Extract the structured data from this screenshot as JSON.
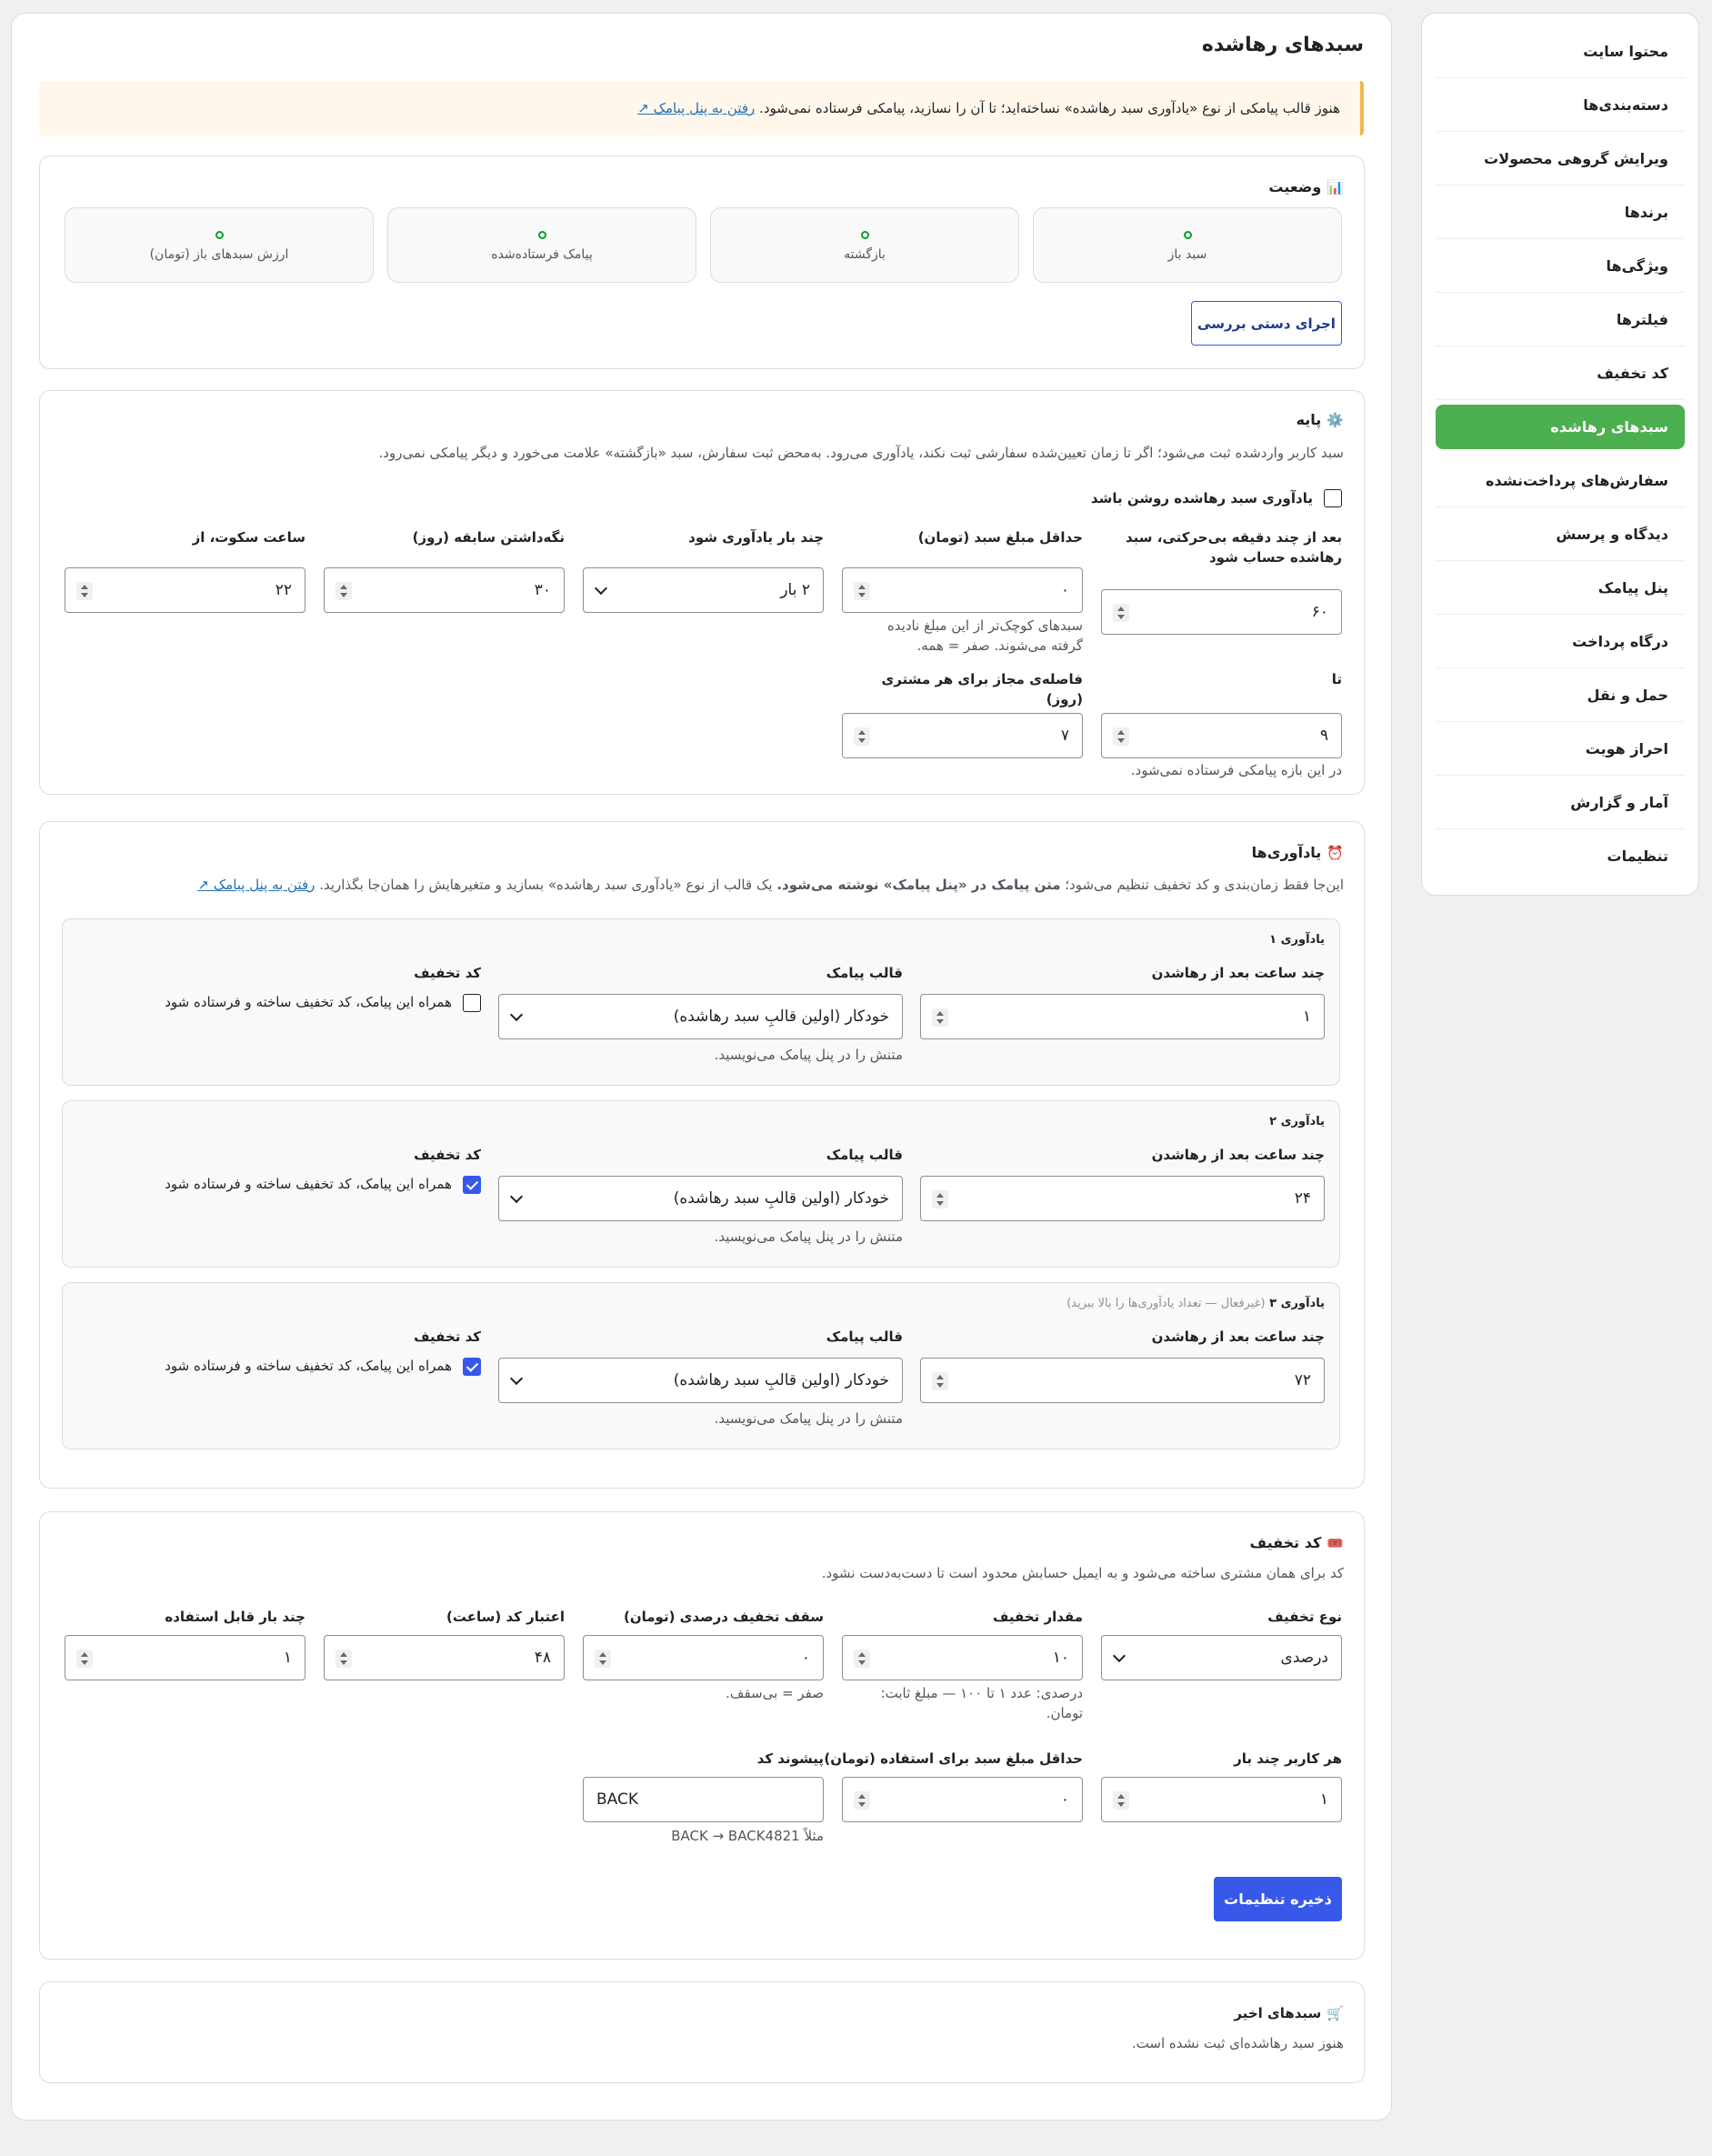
{
  "sidebar": {
    "items": [
      {
        "label": "محتوا سایت",
        "active": false
      },
      {
        "label": "دسته‌بندی‌ها",
        "active": false
      },
      {
        "label": "ویرایش گروهی محصولات",
        "active": false
      },
      {
        "label": "برندها",
        "active": false
      },
      {
        "label": "ویژگی‌ها",
        "active": false
      },
      {
        "label": "فیلترها",
        "active": false
      },
      {
        "label": "کد تخفیف",
        "active": false
      },
      {
        "label": "سبدهای رهاشده",
        "active": true
      },
      {
        "label": "سفارش‌های پرداخت‌نشده",
        "active": false
      },
      {
        "label": "دیدگاه و پرسش",
        "active": false
      },
      {
        "label": "پنل پیامک",
        "active": false
      },
      {
        "label": "درگاه پرداخت",
        "active": false
      },
      {
        "label": "حمل و نقل",
        "active": false
      },
      {
        "label": "احراز هویت",
        "active": false
      },
      {
        "label": "آمار و گزارش",
        "active": false
      },
      {
        "label": "تنظیمات",
        "active": false
      }
    ]
  },
  "page": {
    "title": "سبدهای رهاشده",
    "notice_text": "هنوز قالب پیامکی از نوع «یادآوری سبد رهاشده» نساخته‌اید؛ تا آن را نسازید، پیامکی فرستاده نمی‌شود.",
    "notice_link": "رفتن به پنل پیامک ↗"
  },
  "status": {
    "title": "وضعیت",
    "icon": "bar-chart-icon",
    "stats": [
      {
        "label": "سبد باز",
        "value": "0"
      },
      {
        "label": "بازگشته",
        "value": "0"
      },
      {
        "label": "پیامک فرستاده‌شده",
        "value": "0"
      },
      {
        "label": "ارزش سبدهای باز (تومان)",
        "value": "0"
      }
    ],
    "run_button": "اجرای دستی بررسی"
  },
  "base": {
    "title": "پایه",
    "icon": "gear-icon",
    "desc": "سبد کاربر واردشده ثبت می‌شود؛ اگر تا زمان تعیین‌شده سفارشی ثبت نکند، یادآوری می‌رود. به‌محض ثبت سفارش، سبد «بازگشته» علامت می‌خورد و دیگر پیامکی نمی‌رود.",
    "enable_label": "یادآوری سبد رهاشده روشن باشد",
    "enabled": false,
    "fields": {
      "idle_minutes": {
        "label": "بعد از چند دقیقه بی‌حرکتی، سبد رهاشده حساب شود",
        "value": "۶۰"
      },
      "min_amount": {
        "label": "حداقل مبلغ سبد (تومان)",
        "value": "۰",
        "help": "سبدهای کوچک‌تر از این مبلغ نادیده گرفته می‌شوند. صفر = همه."
      },
      "times": {
        "label": "چند بار یادآوری شود",
        "value": "۲ بار"
      },
      "keep_days": {
        "label": "نگه‌داشتن سابقه (روز)",
        "value": "۳۰"
      },
      "quiet_from": {
        "label": "ساعت سکوت، از",
        "value": "۲۲"
      },
      "quiet_to": {
        "label": "تا",
        "value": "۹",
        "help": "در این بازه پیامکی فرستاده نمی‌شود."
      },
      "gap_days": {
        "label": "فاصله‌ی مجاز برای هر مشتری (روز)",
        "value": "۷"
      }
    }
  },
  "reminders": {
    "title": "یادآوری‌ها",
    "icon": "alarm-clock-icon",
    "desc_plain": "این‌جا فقط زمان‌بندی و کد تخفیف تنظیم می‌شود؛ ",
    "desc_bold": "متن پیامک در «پنل پیامک» نوشته می‌شود.",
    "desc_after": " یک قالب از نوع «یادآوری سبد رهاشده» بسازید و متغیرهایش را همان‌جا بگذارید.",
    "desc_link": "رفتن به پنل پیامک ↗",
    "hours_label": "چند ساعت بعد از رهاشدن",
    "template_label": "قالب پیامک",
    "template_help": "متنش را در پنل پیامک می‌نویسید.",
    "discount_label": "کد تخفیف",
    "discount_check_label": "همراه این پیامک، کد تخفیف ساخته و فرستاده شود",
    "items": [
      {
        "title": "یادآوری ۱",
        "subtitle": "",
        "hours": "۱",
        "template": "خودکار (اولین قالبِ سبد رهاشده)",
        "discount": false
      },
      {
        "title": "یادآوری ۲",
        "subtitle": "",
        "hours": "۲۴",
        "template": "خودکار (اولین قالبِ سبد رهاشده)",
        "discount": true
      },
      {
        "title": "یادآوری ۳",
        "subtitle": "(غیرفعال — تعداد یادآوری‌ها را بالا ببرید)",
        "hours": "۷۲",
        "template": "خودکار (اولین قالبِ سبد رهاشده)",
        "discount": true
      }
    ]
  },
  "coupon": {
    "title": "کد تخفیف",
    "icon": "ticket-icon",
    "desc": "کد برای همان مشتری ساخته می‌شود و به ایمیل حسابش محدود است تا دست‌به‌دست نشود.",
    "fields": {
      "type": {
        "label": "نوع تخفیف",
        "value": "درصدی"
      },
      "amount": {
        "label": "مقدار تخفیف",
        "value": "۱۰",
        "help": "درصدی: عدد ۱ تا ۱۰۰ — مبلغ ثابت: تومان."
      },
      "cap": {
        "label": "سقف تخفیف درصدی (تومان)",
        "value": "۰",
        "help": "صفر = بی‌سقف."
      },
      "valid_hours": {
        "label": "اعتبار کد (ساعت)",
        "value": "۴۸"
      },
      "usage_limit": {
        "label": "چند بار قابل استفاده",
        "value": "۱"
      },
      "per_user": {
        "label": "هر کاربر چند بار",
        "value": "۱"
      },
      "min_cart": {
        "label": "حداقل مبلغ سبد برای استفاده (تومان)",
        "value": "۰"
      },
      "prefix": {
        "label": "پیشوند کد",
        "value": "BACK",
        "help": "مثلاً BACK → BACK4821"
      }
    },
    "save_button": "ذخیره تنظیمات"
  },
  "recent": {
    "title": "سبدهای اخیر",
    "icon": "cart-icon",
    "empty": "هنوز سبد رهاشده‌ای ثبت نشده است."
  }
}
